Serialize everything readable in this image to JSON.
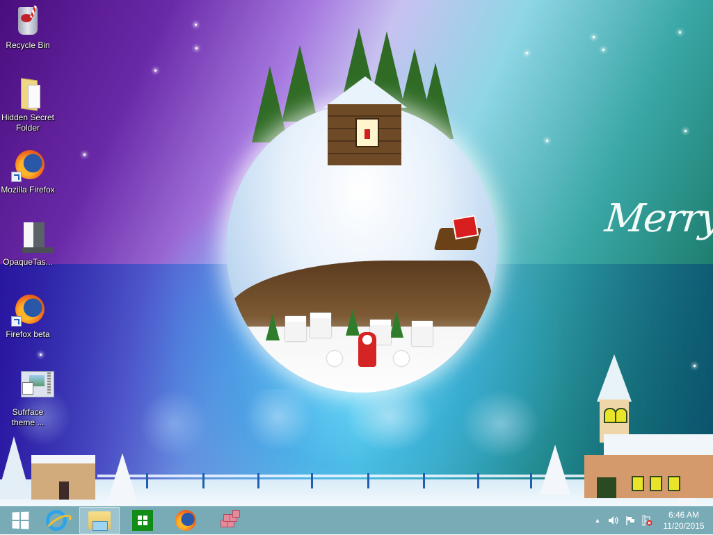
{
  "desktop": {
    "wallpaper": {
      "description": "Christmas snow globe wallpaper with cabin, pine trees, santa, snowmen, church",
      "greeting_text": "Merry",
      "colors": {
        "top_left": "#4a0d7e",
        "center": "#c7c2f0",
        "right": "#1c7b6b",
        "glow": "#78e6ff"
      }
    },
    "icons": [
      {
        "label": "Recycle Bin",
        "icon": "recycle-bin-icon",
        "shortcut": false
      },
      {
        "label": "Hidden Secret Folder",
        "icon": "folder-icon",
        "shortcut": false
      },
      {
        "label": "Mozilla Firefox",
        "icon": "firefox-icon",
        "shortcut": true
      },
      {
        "label": "OpaqueTas...",
        "icon": "opaque-taskbar-app-icon",
        "shortcut": false
      },
      {
        "label": "Firefox beta",
        "icon": "firefox-icon",
        "shortcut": true
      },
      {
        "label": "Sufrface theme ...",
        "icon": "theme-pack-icon",
        "shortcut": false
      }
    ]
  },
  "taskbar": {
    "background": "#79abb6",
    "start": {
      "icon": "windows-logo-icon"
    },
    "pinned": [
      {
        "name": "Internet Explorer",
        "icon": "internet-explorer-icon",
        "active": false
      },
      {
        "name": "File Explorer",
        "icon": "file-explorer-icon",
        "active": true
      },
      {
        "name": "Store",
        "icon": "store-icon",
        "active": false
      },
      {
        "name": "Firefox",
        "icon": "firefox-icon",
        "active": false
      },
      {
        "name": "Application",
        "icon": "pink-cubes-icon",
        "active": false
      }
    ],
    "tray": {
      "show_hidden": "▲",
      "volume": "volume-icon",
      "action_center": "flag-icon",
      "network": "network-disconnected-icon"
    },
    "clock": {
      "time": "6:46 AM",
      "date": "11/20/2015"
    }
  }
}
